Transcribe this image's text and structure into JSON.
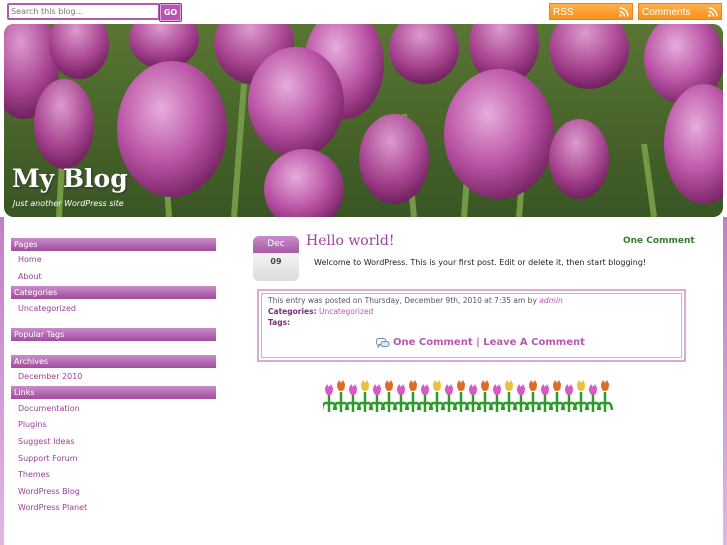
{
  "topbar": {
    "search_placeholder": "Search this blog...",
    "search_button": "GO",
    "rss_label": "RSS",
    "comments_label": "Comments"
  },
  "header": {
    "title": "My Blog",
    "tagline": "Just another WordPress site"
  },
  "sidebar": {
    "pages_heading": "Pages",
    "pages": [
      "Home",
      "About"
    ],
    "categories_heading": "Categories",
    "categories": [
      "Uncategorized"
    ],
    "popular_tags_heading": "Popular Tags",
    "archives_heading": "Archives",
    "archives": [
      "December 2010"
    ],
    "links_heading": "Links",
    "links": [
      "Documentation",
      "Plugins",
      "Suggest Ideas",
      "Support Forum",
      "Themes",
      "WordPress Blog",
      "WordPress Planet"
    ]
  },
  "post": {
    "date_month": "Dec",
    "date_day": "09",
    "title": "Hello world!",
    "comments_count": "One Comment",
    "body": "Welcome to WordPress. This is your first post. Edit or delete it, then start blogging!",
    "meta_posted": "This entry was posted on Thursday, December 9th, 2010 at 7:35 am by",
    "meta_author": "admin",
    "categories_label": "Categories:",
    "categories_value": "Uncategorized",
    "tags_label": "Tags:",
    "comment_link": "One Comment",
    "separator": "|",
    "leave_comment": "Leave A Comment"
  },
  "colors": {
    "accent": "#a0429d",
    "link": "#9b3e98",
    "feed_orange": "#f7911c",
    "comment_green": "#3d7a35"
  }
}
